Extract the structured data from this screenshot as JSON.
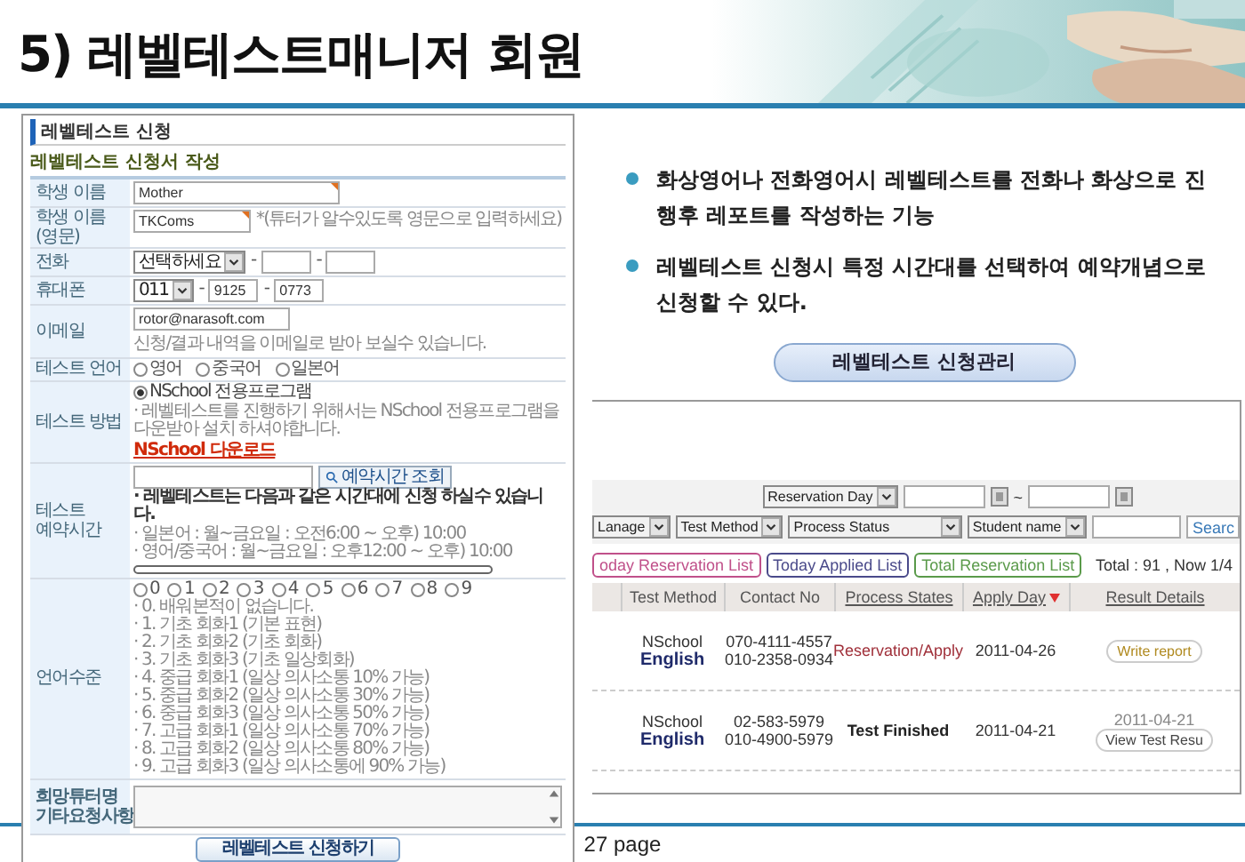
{
  "slide": {
    "title": "5) 레벨테스트매니저 회원",
    "page": "27 page"
  },
  "bullets": [
    "화상영어나 전화영어시 레벨테스트를 전화나 화상으로 진행후 레포트를 작성하는 기능",
    "레벨테스트 신청시 특정 시간대를 선택하여 예약개념으로 신청할 수 있다."
  ],
  "manage_button": "레벨테스트 신청관리",
  "form_window": {
    "title": "레벨테스트 신청",
    "subtitle": "레벨테스트 신청서 작성",
    "rows": [
      {
        "label": "학생 이름",
        "kind": "input",
        "value": "Mother",
        "required": true
      },
      {
        "label": "학생 이름(영문)",
        "kind": "input",
        "value": "TKComs",
        "required": true,
        "note": "*(튜터가 알수있도록 영문으로 입력하세요)"
      },
      {
        "label": "전화",
        "kind": "phone_blank",
        "select": "선택하세요",
        "separator": "-"
      },
      {
        "label": "휴대폰",
        "kind": "phone",
        "select": "011",
        "separator": "-",
        "values": [
          "9125",
          "0773"
        ]
      },
      {
        "label": "이메일",
        "kind": "input",
        "value": "rotor@narasoft.com",
        "required": false,
        "note": "신청/결과 내역을 이메일로 받아 보실수 있습니다."
      },
      {
        "label": "테스트 언어",
        "kind": "radios",
        "options": [
          {
            "label": "영어",
            "selected": false
          },
          {
            "label": "중국어",
            "selected": false
          },
          {
            "label": "일본어",
            "selected": false
          }
        ]
      },
      {
        "label": "테스트 방법",
        "kind": "method",
        "options": [
          {
            "label": "NSchool 전용프로그램",
            "selected": true
          }
        ],
        "notes": [
          "· 레벨테스트를 진행하기 위해서는 NSchool 전용프로그램을 다운받아 설치 하셔야합니다."
        ],
        "link": "NSchool 다운로드"
      },
      {
        "label": "테스트 예약시간",
        "kind": "reservation",
        "button": "예약시간 조회",
        "notes": [
          {
            "text": "· 레벨테스트는 다음과 같은 시간대에 신청 하실수 있습니다.",
            "emphasis": true
          },
          {
            "text": "· 일본어 : 월~금요일 : 오전6:00 ~ 오후) 10:00",
            "emphasis": false
          },
          {
            "text": "· 영어/중국어 : 월~금요일 : 오후12:00 ~ 오후) 10:00",
            "emphasis": false
          }
        ]
      },
      {
        "label": "언어수준",
        "kind": "level",
        "options": [
          {
            "label": "0",
            "selected": false
          },
          {
            "label": "1",
            "selected": false
          },
          {
            "label": "2",
            "selected": false
          },
          {
            "label": "3",
            "selected": false
          },
          {
            "label": "4",
            "selected": false
          },
          {
            "label": "5",
            "selected": false
          },
          {
            "label": "6",
            "selected": false
          },
          {
            "label": "7",
            "selected": false
          },
          {
            "label": "8",
            "selected": false
          },
          {
            "label": "9",
            "selected": false
          }
        ],
        "notes": [
          "· 0. 배워본적이 없습니다.",
          "· 1. 기초 회화1 (기본 표현)",
          "· 2. 기초 회화2 (기초 회화)",
          "· 3. 기초 회화3 (기초 일상회화)",
          "· 4. 중급 회화1 (일상 의사소통 10% 가능)",
          "· 5. 중급 회화2 (일상 의사소통 30% 가능)",
          "· 6. 중급 회화3 (일상 의사소통 50% 가능)",
          "· 7. 고급 회화1 (일상 의사소통 70% 가능)",
          "· 8. 고급 회화2 (일상 의사소통 80% 가능)",
          "· 9. 고급 회화3 (일상 의사소통에 90% 가능)"
        ]
      },
      {
        "label": "희망튜터명 기타요청사항",
        "kind": "textarea"
      }
    ],
    "submit": "레벨테스트 신청하기"
  },
  "list_window": {
    "date_filter": {
      "select": "Reservation Day",
      "separator": "~"
    },
    "filters": [
      "Lanage",
      "Test Method",
      "Process Status",
      "Student name"
    ],
    "search_button": "Searc",
    "tabs": [
      {
        "label": "oday Reservation List",
        "color": "#c0508a"
      },
      {
        "label": "Today Applied List",
        "color": "#4a4a8a"
      },
      {
        "label": "Total Reservation List",
        "color": "#5a9a4a"
      }
    ],
    "total": "Total : 91 , Now 1/4",
    "columns": [
      {
        "label": "Test Method",
        "link": false,
        "sorted": false
      },
      {
        "label": "Contact No",
        "link": false,
        "sorted": false
      },
      {
        "label": "Process States",
        "link": true,
        "sorted": false
      },
      {
        "label": "Apply Day",
        "link": true,
        "sorted": true
      },
      {
        "label": "Result Details",
        "link": true,
        "sorted": false
      }
    ],
    "rows": [
      {
        "method": "NSchool",
        "language": "English",
        "contacts": [
          "070-4111-4557",
          "010-2358-0934"
        ],
        "status": "Reservation/Apply",
        "highlighted": true,
        "apply_day": "2011-04-26",
        "result": {
          "kind": "report",
          "label": "Write report"
        }
      },
      {
        "method": "NSchool",
        "language": "English",
        "contacts": [
          "02-583-5979",
          "010-4900-5979"
        ],
        "status": "Test Finished",
        "highlighted": false,
        "apply_day": "2011-04-21",
        "result": {
          "kind": "view",
          "date": "2011-04-21",
          "label": "View Test Resu"
        }
      }
    ]
  }
}
